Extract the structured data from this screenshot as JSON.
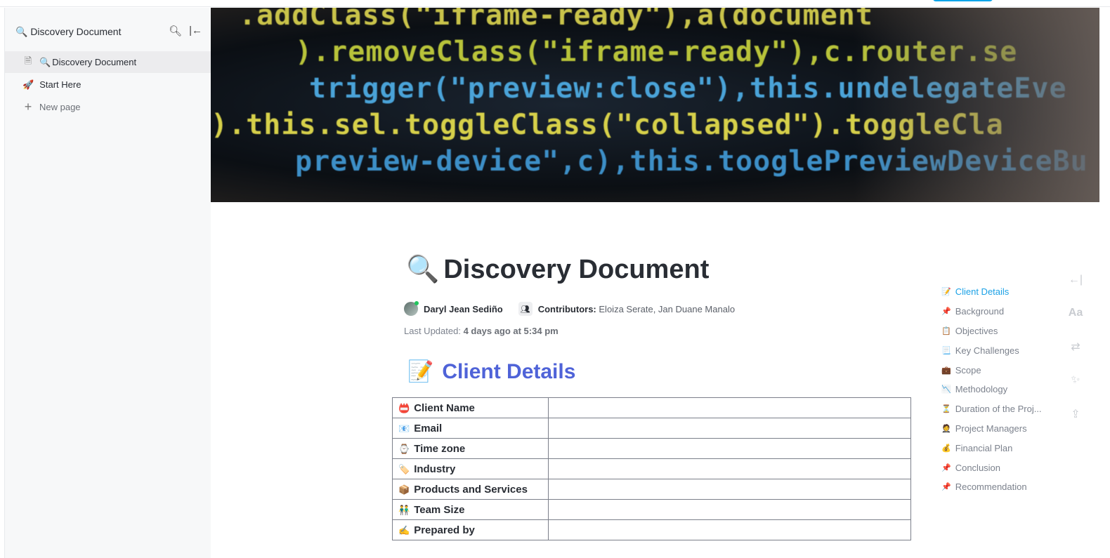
{
  "sidebar": {
    "title": "🔍 Discovery Document",
    "items": [
      {
        "icon": "🔍",
        "label": "Discovery Document"
      },
      {
        "icon": "🚀",
        "label": "Start Here"
      },
      {
        "label": "New page"
      }
    ]
  },
  "cover": {
    "lines": [
      ".addClass(\"iframe-ready\"),a(document",
      ").removeClass(\"iframe-ready\"),c.router.se",
      "trigger(\"preview:close\"),this.undelegateEve",
      ").this.sel.toggleClass(\"collapsed\").toggleCla",
      "preview-device\",c),this.tooglePreviewDeviceBu"
    ]
  },
  "doc": {
    "title_icon": "🔍",
    "title": "Discovery Document",
    "author": "Daryl Jean Sediño",
    "contributors_label": "Contributors:",
    "contributors": "Eloiza Serate, Jan Duane Manalo",
    "updated_label": "Last Updated:",
    "updated": "4 days ago at 5:34 pm"
  },
  "section": {
    "icon": "📝",
    "title": "Client Details"
  },
  "table": [
    {
      "icon": "📛",
      "label": "Client Name",
      "value": ""
    },
    {
      "icon": "📧",
      "label": "Email",
      "value": ""
    },
    {
      "icon": "⌚",
      "label": "Time zone",
      "value": ""
    },
    {
      "icon": "🏷️",
      "label": "Industry",
      "value": ""
    },
    {
      "icon": "📦",
      "label": "Products and Services",
      "value": ""
    },
    {
      "icon": "👬",
      "label": "Team Size",
      "value": ""
    },
    {
      "icon": "✍️",
      "label": "Prepared by",
      "value": ""
    }
  ],
  "toc": [
    {
      "icon": "📝",
      "label": "Client Details"
    },
    {
      "icon": "📌",
      "label": "Background"
    },
    {
      "icon": "📋",
      "label": "Objectives"
    },
    {
      "icon": "📃",
      "label": "Key Challenges"
    },
    {
      "icon": "💼",
      "label": "Scope"
    },
    {
      "icon": "📉",
      "label": "Methodology"
    },
    {
      "icon": "⏳",
      "label": "Duration of the Proj..."
    },
    {
      "icon": "🤵",
      "label": "Project Managers"
    },
    {
      "icon": "💰",
      "label": "Financial Plan"
    },
    {
      "icon": "📌",
      "label": "Conclusion"
    },
    {
      "icon": "📌",
      "label": "Recommendation"
    }
  ],
  "colors": {
    "accent": "#4f63d8",
    "toc_active": "#1ba1e6"
  }
}
